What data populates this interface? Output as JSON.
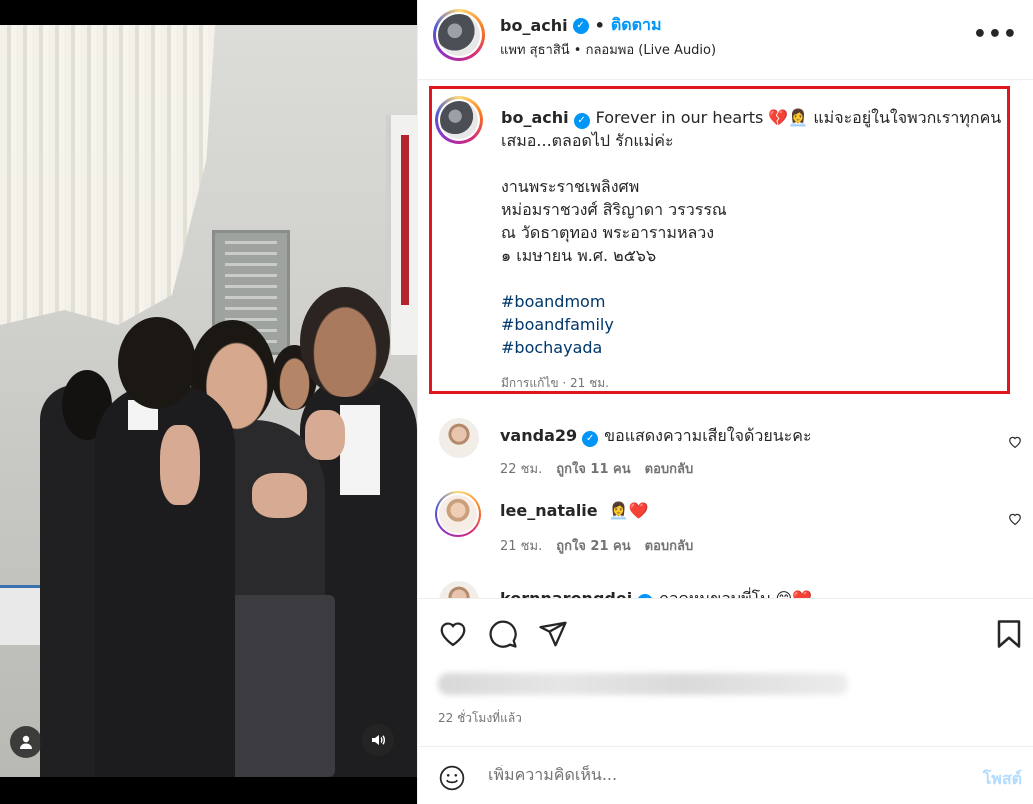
{
  "header": {
    "username": "bo_achi",
    "follow_label": "ติดตาม",
    "dot": "•",
    "subtitle": "แพท สุธาสินี • กลอมพอ (Live Audio)",
    "more_label": "•••"
  },
  "caption": {
    "username": "bo_achi",
    "text_line1": "Forever in our hearts 💔👩‍💼 แม่จะอยู่ในใจพวกเราทุกคน",
    "text_line2": "เสมอ...ตลอดไป รักแม่ค่ะ",
    "event_lines": [
      "งานพระราชเพลิงศพ",
      "หม่อมราชวงศ์ สิริญาดา วรวรรณ",
      "ณ วัดธาตุทอง พระอารามหลวง",
      "๑ เมษายน พ.ศ. ๒๕๖๖"
    ],
    "hashtags": [
      "#boandmom",
      "#boandfamily",
      "#bochayada"
    ],
    "meta": "มีการแก้ไข · 21 ชม."
  },
  "comments": [
    {
      "username": "vanda29",
      "verified": true,
      "text": "ขอแสดงความเสียใจด้วยนะคะ",
      "time": "22 ชม.",
      "likes": "ถูกใจ 11 คน",
      "reply_label": "ตอบกลับ"
    },
    {
      "username": "lee_natalie",
      "verified": false,
      "text": "👩‍💼❤️",
      "time": "21 ชม.",
      "likes": "ถูกใจ 21 คน",
      "reply_label": "ตอบกลับ"
    },
    {
      "username": "kornnarongdej",
      "verified": true,
      "text": "กอดหนุขอบพี่โบ 😊❤️",
      "time": "",
      "likes": "",
      "reply_label": ""
    }
  ],
  "post": {
    "timestamp": "22 ชั่วโมงที่แล้ว",
    "add_comment_placeholder": "เพิ่มความคิดเห็น...",
    "post_label": "โพสต์"
  },
  "icons": {
    "verified": "verified-badge-icon",
    "like": "heart-icon",
    "comment": "comment-bubble-icon",
    "share": "paper-plane-icon",
    "save": "bookmark-icon",
    "emoji": "smiley-icon",
    "user_tag": "person-icon",
    "audio": "speaker-icon"
  },
  "colors": {
    "follow": "#0095f6",
    "hashtag": "#00376b",
    "highlight_border": "#e0181b",
    "muted": "#737373",
    "post_disabled": "#b3dbff"
  }
}
